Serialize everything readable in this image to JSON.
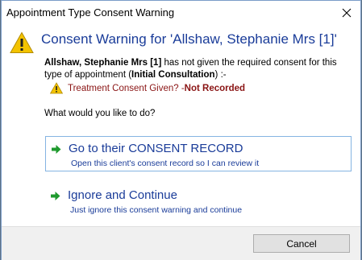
{
  "window": {
    "title": "Appointment Type Consent Warning"
  },
  "header": {
    "heading": "Consent Warning for 'Allshaw, Stephanie Mrs [1]'"
  },
  "message": {
    "client_name": "Allshaw, Stephanie Mrs [1]",
    "text_part1": " has not given the required consent for this type of appointment (",
    "appointment_type": "Initial Consultation",
    "text_part2": ") :-"
  },
  "consent": {
    "label": "Treatment Consent Given? - ",
    "status": "Not Recorded"
  },
  "prompt": "What would you like to do?",
  "choices": [
    {
      "title": "Go to their CONSENT RECORD",
      "subtitle": "Open this client's consent record so I can review it"
    },
    {
      "title": "Ignore and Continue",
      "subtitle": "Just ignore this consent warning and continue"
    }
  ],
  "footer": {
    "cancel_label": "Cancel"
  },
  "colors": {
    "accent_text": "#1a3c99",
    "warning_text": "#8a1414",
    "arrow_green": "#1f9a2e",
    "warning_yellow": "#f3c300",
    "selection_border": "#85b4e2"
  },
  "icons": {
    "main": "warning-triangle-icon",
    "consent": "warning-triangle-icon",
    "choice": "green-arrow-icon",
    "close": "close-icon"
  }
}
